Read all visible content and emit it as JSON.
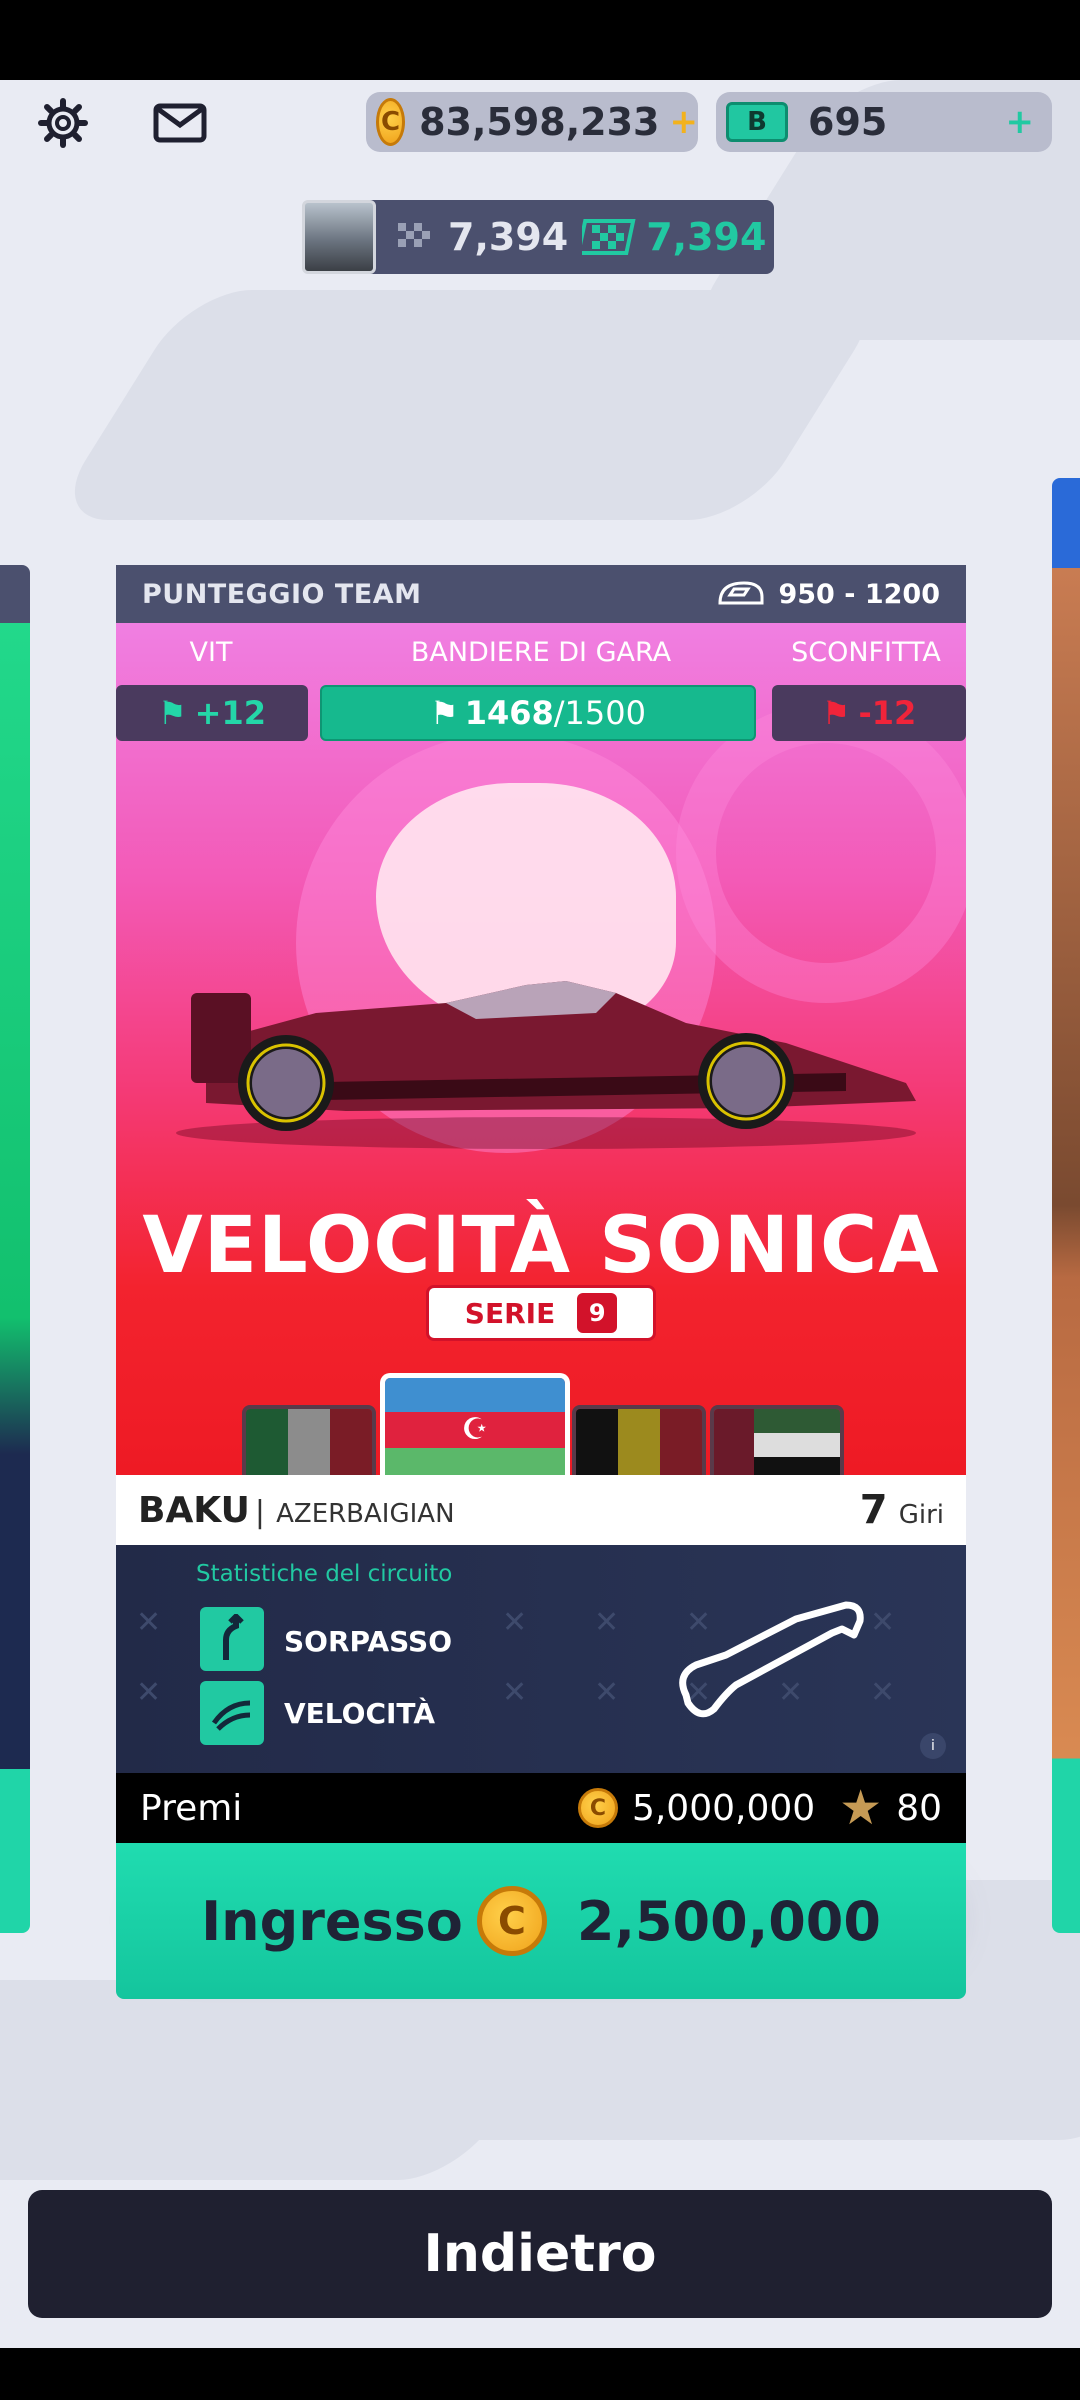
{
  "top_bar": {
    "coins": "83,598,233",
    "bucks": "695",
    "bucks_letter": "B",
    "coin_letter": "C"
  },
  "player": {
    "flags_value": "7,394",
    "flags_value_2": "7,394"
  },
  "card": {
    "header_label": "PUNTEGGIO TEAM",
    "range": "950 - 1200",
    "win_label": "VIT",
    "flags_label": "BANDIERE DI GARA",
    "loss_label": "SCONFITTA",
    "win_value": "+12",
    "flags_progress": "1468",
    "flags_total": "/1500",
    "loss_value": "-12",
    "race_name": "VELOCITÀ SONICA",
    "series_label": "SERIE",
    "series_number": "9",
    "city": "BAKU",
    "country": "AZERBAIGIAN",
    "laps": "7",
    "laps_label": "Giri",
    "stats_title": "Statistiche del circuito",
    "stat_1": "SORPASSO",
    "stat_2": "VELOCITÀ",
    "prizes_label": "Premi",
    "prize_coins": "5,000,000",
    "prize_stars": "80",
    "entry_label": "Ingresso",
    "entry_cost": "2,500,000"
  },
  "back_button": "Indietro",
  "colors": {
    "accent_green": "#21c9a2",
    "header": "#4b506e",
    "loss_red": "#d2122a"
  }
}
